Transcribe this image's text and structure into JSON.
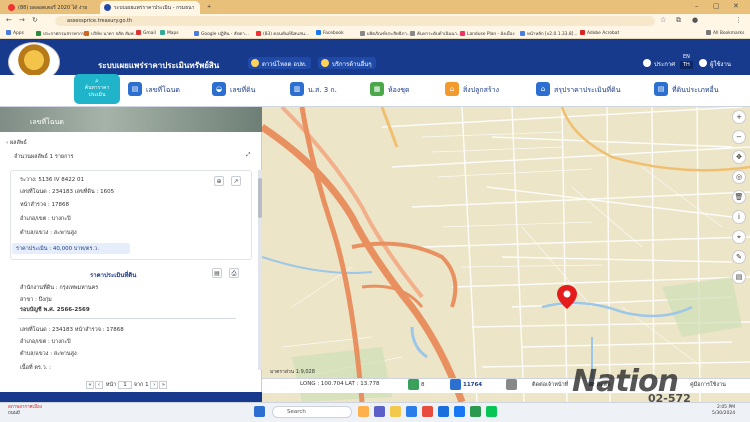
{
  "browser": {
    "tabs": [
      {
        "label": "(88) ผลลอตเตอรี่ 2020 ได้ ง่าย",
        "color": "#e33"
      },
      {
        "label": "ระบบเผยแพร่ราคาประเมิน - กรมธนา",
        "color": "#1f4aa8"
      },
      {
        "label": "+",
        "color": "transparent"
      }
    ],
    "url": "assessprice.treasury.go.th",
    "bookmarks": [
      {
        "label": "Apps",
        "color": "#4a7de0"
      },
      {
        "label": "ประกาศกรมสรรพากร",
        "color": "#2b8a3e"
      },
      {
        "label": "บริษัท นาคา จสัด สัมพ...",
        "color": "#c62"
      },
      {
        "label": "Gmail",
        "color": "#d33"
      },
      {
        "label": "Maps",
        "color": "#3a9"
      },
      {
        "label": "Google ปฏิทิน - สัปดา...",
        "color": "#4a7de0"
      },
      {
        "label": "(83) ดอนทันท์นิสแสน...",
        "color": "#e33"
      },
      {
        "label": "Facebook",
        "color": "#1877f2"
      },
      {
        "label": "ผลิตภัณฑ์ประสิทธิภา...",
        "color": "#888"
      },
      {
        "label": "ค้นหาระดับดำเนินนา...",
        "color": "#888"
      },
      {
        "label": "Landuse Plan - ผังเมือง",
        "color": "#e36"
      },
      {
        "label": "หน้าหลัก [v2.0.1.33.8]...",
        "color": "#4a7de0"
      },
      {
        "label": "Adobe Acrobat",
        "color": "#d22"
      },
      {
        "label": "All Bookmarks",
        "color": "#777"
      }
    ]
  },
  "header": {
    "site_title": "ระบบเผยแพร่ราคาประเมินทรัพย์สิน",
    "download_btn": "ดาวน์โหลด อปท.",
    "ecommerce_btn": "บริการด้านอื่นๆ",
    "announce": "ประกาศ",
    "lang_en": "EN",
    "lang_th": "TH",
    "user": "ผู้ใช้งาน"
  },
  "nav": {
    "search_label_1": "ค้นหาราคา",
    "search_label_2": "ประเมิน",
    "items": [
      {
        "label": "เลขที่โฉนด"
      },
      {
        "label": "เลขที่ดิน"
      },
      {
        "label": "น.ส. 3 ก."
      },
      {
        "label": "ห้องชุด"
      },
      {
        "label": "สิ่งปลูกสร้าง"
      },
      {
        "label": "สรุปราคาประเมินที่ดิน"
      },
      {
        "label": "ที่ดินประเภทอื่น"
      }
    ]
  },
  "panel": {
    "photo_title": "เลขที่โฉนด",
    "back_label": "ผลลัพธ์",
    "result_count": "จำนวนผลลัพธ์ 1 รายการ",
    "coord": "ระวาง: 5136 IV 8422 01",
    "deed": "เลขที่โฉนด : 234183 เลขที่ดิน : 1605",
    "survey": "หน้าสำรวจ : 17868",
    "district": "อำเภอ/เขต : บางกะปิ",
    "subdistrict": "ตำบล/แขวง : สะพานสูง",
    "price": "ราคาประเมิน : 40,000 บาท/ตร.ว.",
    "section_title": "ราคาประเมินที่ดิน",
    "office": "สำนักงานที่ดิน : กรุงเทพมหานคร",
    "branch": "สาขา : บึงกุ่ม",
    "period": "รอบบัญชี พ.ศ. 2566-2569",
    "deed2": "เลขที่โฉนด : 234183 หน้าสำรวจ : 17868",
    "district2": "อำเภอ/เขต : บางกะปิ",
    "subdistrict2": "ตำบล/แขวง : สะพานสูง",
    "truncated": "เนื้อที่ ตร.ว. :",
    "pager_page": "หน้า",
    "pager_current": "1",
    "pager_of": "จาก",
    "pager_total": "1"
  },
  "map": {
    "scale_label": "มาตราส่วน 1:9,028",
    "long": "LONG : 100.704",
    "lat": "LAT : 13.778",
    "count_people": "8",
    "count_visits": "11764",
    "contact_label": "ติดต่อเจ้าหน้าที่",
    "phone_label": "ติดต่อ",
    "help_label": "คู่มือการใช้งาน"
  },
  "taskbar": {
    "weather_1": "สภาพอากาศเมือง",
    "weather_2": "ถนนมี",
    "search": "Search",
    "time": "2:05 PM",
    "date": "5/30/2024"
  },
  "watermark": {
    "brand": "Nation",
    "phone": "02-572"
  }
}
